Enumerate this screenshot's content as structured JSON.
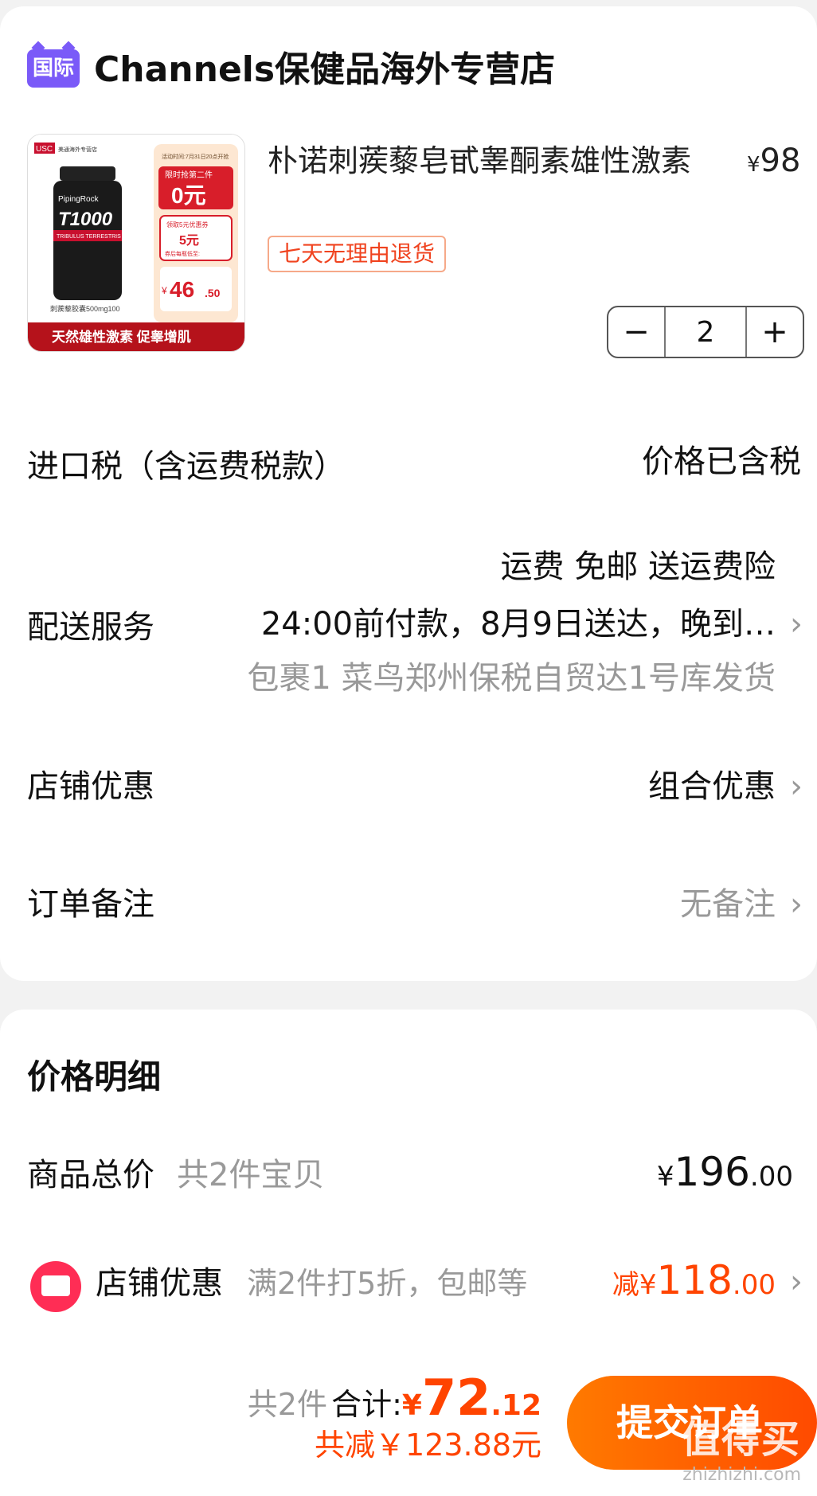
{
  "store": {
    "badge": "国际",
    "name": "Channels保健品海外专营店"
  },
  "product": {
    "title": "朴诺刺蒺藜皂甙睾酮素雄性激素",
    "price_currency": "¥",
    "price": "98",
    "return_tag": "七天无理由退货",
    "quantity": "2",
    "image": {
      "brand_tag": "USC",
      "brand_sub": "美通海外专营店",
      "promo_note": "活动时间:7月31日20点开抢",
      "promo_line1": "限时抢第二件",
      "promo_big": "0元",
      "coupon_line1": "领取5元优惠券",
      "coupon_big": "5元",
      "coupon_line2": "券后每瓶低至:",
      "low_price_cur": "¥",
      "low_price": "46",
      "low_price_dec": ".50",
      "bottle_brand": "PipingRock",
      "bottle_name": "T1000",
      "bottle_sub": "TRIBULUS TERRESTRIS",
      "spec": "刺蒺藜胶囊500mg100",
      "footer": "天然雄性激素 促睾增肌"
    }
  },
  "rows": {
    "tax_label": "进口税（含运费税款）",
    "tax_value": "价格已含税",
    "shipping_label": "配送服务",
    "shipping_line1": "运费 免邮 送运费险",
    "shipping_line2": "24:00前付款，8月9日送达，晚到…",
    "shipping_line3": "包裹1 菜鸟郑州保税自贸达1号库发货",
    "shop_discount_label": "店铺优惠",
    "shop_discount_value": "组合优惠",
    "note_label": "订单备注",
    "note_value": "无备注"
  },
  "price_detail": {
    "title": "价格明细",
    "goods_total_label": "商品总价",
    "goods_total_sub": "共2件宝贝",
    "goods_total_cur": "¥",
    "goods_total_int": "196",
    "goods_total_dec": ".00",
    "shop_label": "店铺优惠",
    "shop_sub": "满2件打5折，包邮等",
    "shop_prefix": "减",
    "shop_cur": "¥",
    "shop_int": "118",
    "shop_dec": ".00"
  },
  "footer": {
    "count": "共2件",
    "total_label": "合计:",
    "total_cur": "¥",
    "total_int": "72",
    "total_dec": ".12",
    "saved": "共减￥123.88元",
    "submit": "提交订单"
  },
  "watermark": {
    "name": "值得买",
    "url": "zhizhizhi.com"
  },
  "colors": {
    "accent": "#ff4400",
    "store_badge": "#7a5af8",
    "shop_icon": "#ff2d55"
  }
}
